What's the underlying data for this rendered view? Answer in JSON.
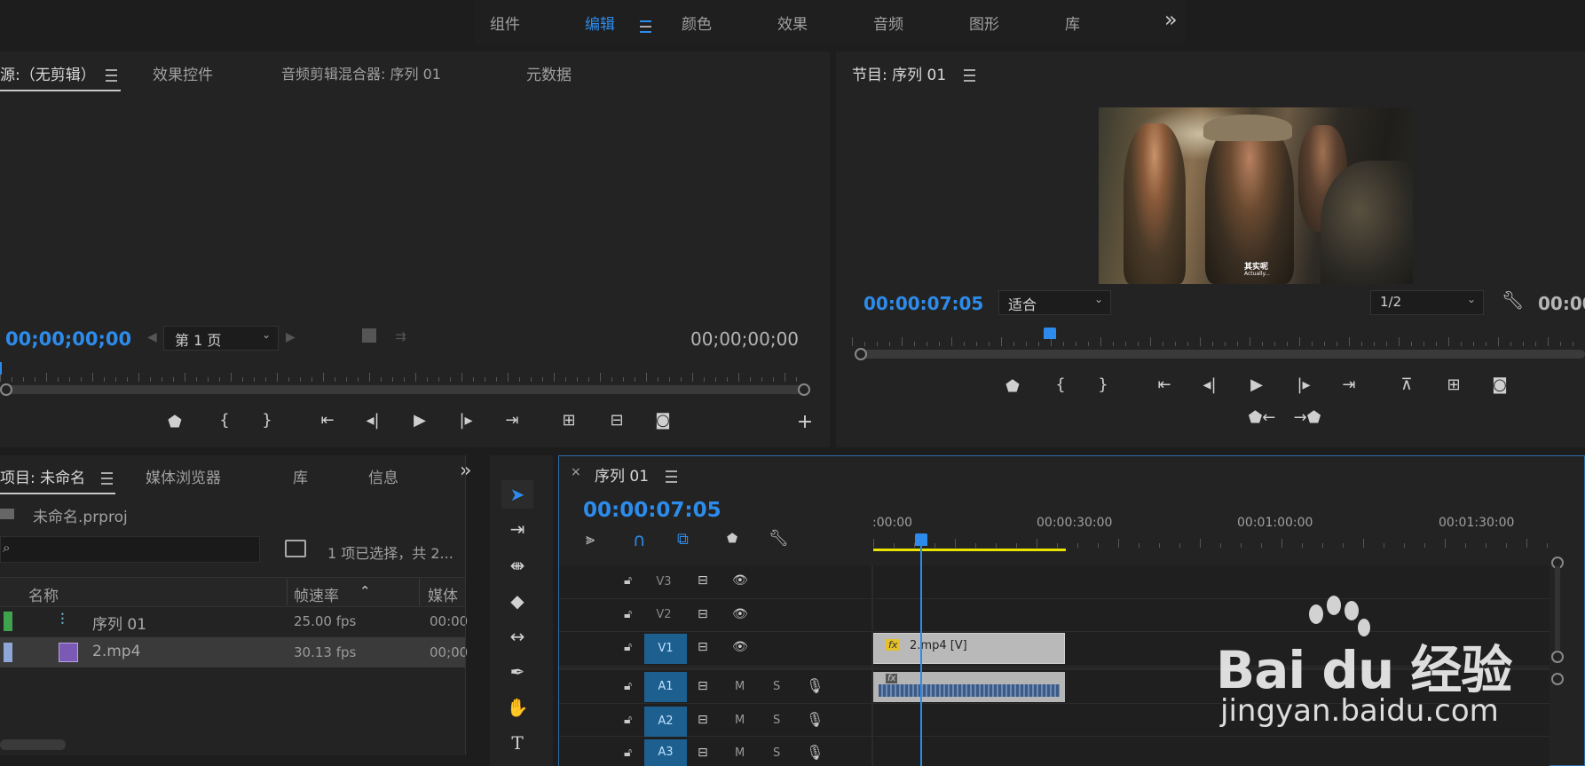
{
  "topbar": {
    "workspaces": [
      "组件",
      "编辑",
      "颜色",
      "效果",
      "音频",
      "图形",
      "库"
    ],
    "active": "编辑",
    "overflow": "»"
  },
  "source_panel": {
    "tabs": [
      "源:（无剪辑）",
      "效果控件",
      "音频剪辑混合器: 序列 01",
      "元数据"
    ],
    "timecode_left": "00;00;00;00",
    "timecode_right": "00;00;00;00",
    "page_select": "第 1 页"
  },
  "program_panel": {
    "title": "节目: 序列 01",
    "timecode": "00:00:07:05",
    "fit_select": "适合",
    "resolution_select": "1/2",
    "timecode_right_partial": "00:00",
    "video_subtitle": "其实呢",
    "video_subtitle_en": "Actually..."
  },
  "project_panel": {
    "tabs": [
      "项目: 未命名",
      "媒体浏览器",
      "库",
      "信息"
    ],
    "project_file": "未命名.prproj",
    "selection_status": "1 项已选择，共 2...",
    "columns": [
      "名称",
      "帧速率",
      "媒体"
    ],
    "items": [
      {
        "name": "序列 01",
        "fps": "25.00 fps",
        "media": "00:00",
        "color": "#3fa34d",
        "icon": "sequence-icon"
      },
      {
        "name": "2.mp4",
        "fps": "30.13 fps",
        "media": "00;00",
        "color": "#8fa6d8",
        "icon": "video-clip-icon"
      }
    ]
  },
  "timeline": {
    "tab": "序列 01",
    "timecode": "00:00:07:05",
    "ruler_labels": [
      ":00:00",
      "00:00:30:00",
      "00:01:00:00",
      "00:01:30:00"
    ],
    "tracks": [
      {
        "name": "V3",
        "kind": "video",
        "selected": false
      },
      {
        "name": "V2",
        "kind": "video",
        "selected": false
      },
      {
        "name": "V1",
        "kind": "video",
        "selected": true
      },
      {
        "name": "A1",
        "kind": "audio",
        "selected": true
      },
      {
        "name": "A2",
        "kind": "audio",
        "selected": true
      },
      {
        "name": "A3",
        "kind": "audio",
        "selected": true
      }
    ],
    "mute_label": "M",
    "solo_label": "S",
    "video_clip": "2.mp4 [V]",
    "fx_label": "fx"
  },
  "watermark": {
    "logo_text": "Bai du 经验",
    "url": "jingyan.baidu.com"
  },
  "colors": {
    "accent": "#2d8ceb",
    "panel": "#232323",
    "track_selected": "#1d5f8f",
    "work_area": "#e8e300"
  }
}
